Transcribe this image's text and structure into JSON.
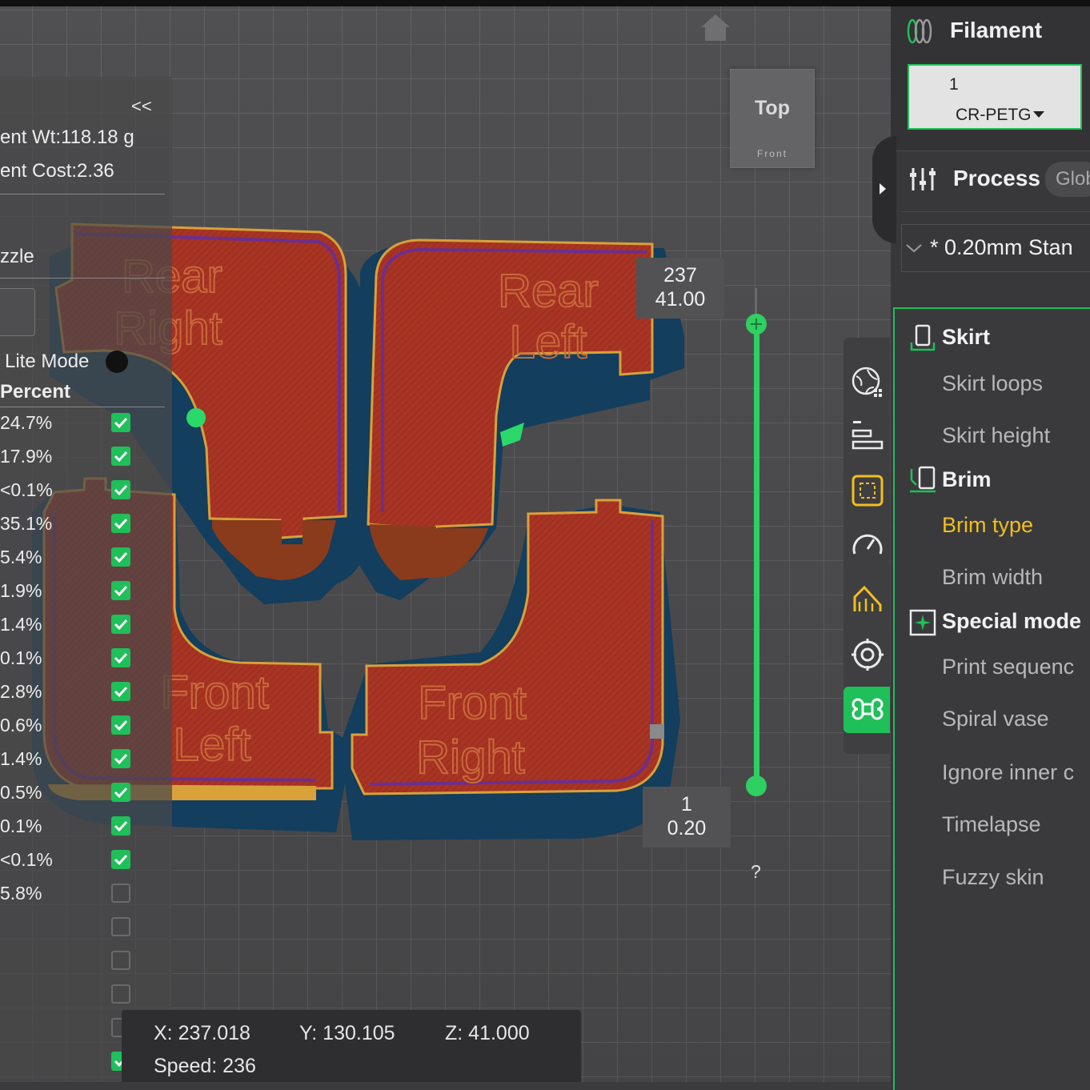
{
  "legend": {
    "collapse_label": "<<",
    "filament_weight": "ent Wt:118.18 g",
    "filament_cost": "ent Cost:2.36",
    "nozzle_label": "zzle",
    "lite_mode_label": "Lite Mode",
    "percent_header": "Percent",
    "rows": [
      {
        "pct": "24.7%",
        "checked": true
      },
      {
        "pct": "17.9%",
        "checked": true
      },
      {
        "pct": "<0.1%",
        "checked": true
      },
      {
        "pct": "35.1%",
        "checked": true
      },
      {
        "pct": "5.4%",
        "checked": true
      },
      {
        "pct": "1.9%",
        "checked": true
      },
      {
        "pct": "1.4%",
        "checked": true
      },
      {
        "pct": "0.1%",
        "checked": true
      },
      {
        "pct": "2.8%",
        "checked": true
      },
      {
        "pct": "0.6%",
        "checked": true
      },
      {
        "pct": "1.4%",
        "checked": true
      },
      {
        "pct": "0.5%",
        "checked": true
      },
      {
        "pct": "0.1%",
        "checked": true
      },
      {
        "pct": "<0.1%",
        "checked": true
      },
      {
        "pct": "5.8%",
        "checked": false
      }
    ]
  },
  "view_cube": {
    "top_label": "Top",
    "front_label": "Front"
  },
  "parts": {
    "rear_right": [
      "Rear",
      "Right"
    ],
    "rear_left": [
      "Rear",
      "Left"
    ],
    "front_left": [
      "Front",
      "Left"
    ],
    "front_right": [
      "Front",
      "Right"
    ]
  },
  "layer_slider": {
    "top_layer": "237",
    "top_height": "41.00",
    "bottom_layer": "1",
    "bottom_height": "0.20",
    "help_label": "?"
  },
  "status": {
    "x": "X: 237.018",
    "y": "Y: 130.105",
    "z": "Z: 41.000",
    "speed": "Speed: 236"
  },
  "right_panel": {
    "filament_title": "Filament",
    "filament_slot": "1",
    "filament_name": "CR-PETG",
    "process_title": "Process",
    "global_button": "Glob",
    "preset": "* 0.20mm Stan",
    "sections": {
      "skirt": "Skirt",
      "brim": "Brim",
      "special": "Special mode"
    },
    "options": {
      "skirt_loops": "Skirt loops",
      "skirt_height": "Skirt height",
      "brim_type": "Brim type",
      "brim_width": "Brim width",
      "print_sequence": "Print sequenc",
      "spiral_vase": "Spiral vase",
      "ignore_inner": "Ignore inner c",
      "timelapse": "Timelapse",
      "fuzzy_skin": "Fuzzy skin"
    }
  },
  "colors": {
    "accent": "#1fbf59",
    "highlight": "#f1bf1d",
    "part_red": "#a63325",
    "part_blue": "#123d5c"
  }
}
